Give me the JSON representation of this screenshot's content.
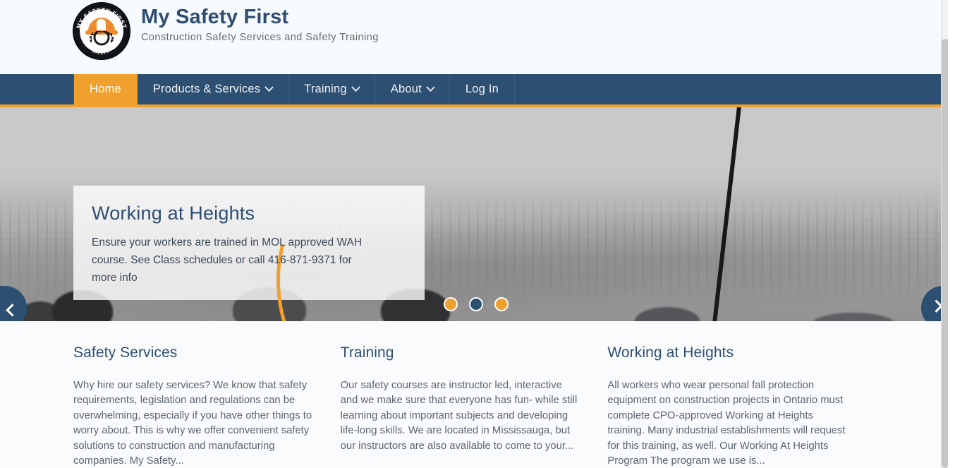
{
  "header": {
    "logo_icon": "my-safety-first-badge-logo",
    "logo_arc_top_text": "MY SAFETY FIRST",
    "logo_arc_bottom_text": "QUALITY · SAFETY · TRAINING",
    "title": "My Safety First",
    "tagline": "Construction Safety Services and Safety Training"
  },
  "nav": {
    "items": [
      {
        "label": "Home",
        "has_dropdown": false,
        "active": true
      },
      {
        "label": "Products & Services",
        "has_dropdown": true,
        "active": false
      },
      {
        "label": "Training",
        "has_dropdown": true,
        "active": false
      },
      {
        "label": "About",
        "has_dropdown": true,
        "active": false
      },
      {
        "label": "Log In",
        "has_dropdown": false,
        "active": false
      }
    ]
  },
  "hero": {
    "caption_title": "Working at Heights",
    "caption_body": "Ensure your workers are trained in MOL approved WAH course. See Class schedules or call 416-871-9371 for more info",
    "prev_icon": "chevron-left-icon",
    "next_icon": "chevron-right-icon",
    "dots": [
      {
        "active": false
      },
      {
        "active": true
      },
      {
        "active": false
      }
    ]
  },
  "columns": [
    {
      "title": "Safety Services",
      "body": "Why hire our safety services? We know that safety requirements, legislation and regulations can be overwhelming, especially if you have other things to worry about. This is why we offer convenient safety solutions to construction and manufacturing companies. My Safety..."
    },
    {
      "title": "Training",
      "body": "Our safety courses are instructor led, interactive and we make sure that everyone has fun- while still learning about important subjects and developing life-long skills. We are located in Mississauga, but our instructors are also available to come to your..."
    },
    {
      "title": "Working at Heights",
      "body": "All workers who wear personal fall protection equipment on construction projects in Ontario must complete CPO-approved Working at Heights training. Many industrial establishments will request for this training, as well.  Our Working At Heights Program The program we use is..."
    }
  ],
  "colors": {
    "navy": "#2d4f72",
    "orange": "#f0a02e",
    "header_bg": "#f7fbfd",
    "body_text": "#5b6470"
  }
}
